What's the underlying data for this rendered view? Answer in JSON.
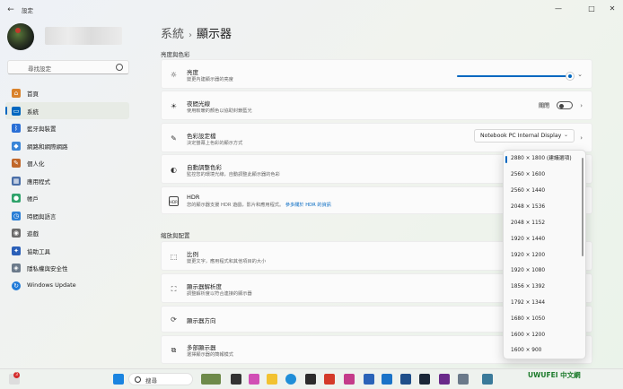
{
  "window": {
    "app_title": "設定",
    "back": "←",
    "minimize": "—",
    "maximize": "□",
    "close": "✕"
  },
  "sidebar": {
    "search_placeholder": "尋找設定",
    "items": [
      {
        "label": "首頁",
        "color": "#d9822b",
        "icon": "home-icon"
      },
      {
        "label": "系統",
        "color": "#0067c0",
        "icon": "system-icon"
      },
      {
        "label": "藍牙與裝置",
        "color": "#2a6fd6",
        "icon": "bluetooth-icon"
      },
      {
        "label": "網路和網際網路",
        "color": "#3a86d8",
        "icon": "wifi-icon"
      },
      {
        "label": "個人化",
        "color": "#c0672a",
        "icon": "brush-icon"
      },
      {
        "label": "應用程式",
        "color": "#4a6fa8",
        "icon": "apps-icon"
      },
      {
        "label": "帳戶",
        "color": "#2fa36b",
        "icon": "account-icon"
      },
      {
        "label": "時間與語言",
        "color": "#2b7fd6",
        "icon": "globe-clock-icon"
      },
      {
        "label": "遊戲",
        "color": "#6b6b6b",
        "icon": "gamepad-icon"
      },
      {
        "label": "協助工具",
        "color": "#2a5fb8",
        "icon": "accessibility-icon"
      },
      {
        "label": "隱私權與安全性",
        "color": "#6b7a8a",
        "icon": "shield-icon"
      },
      {
        "label": "Windows Update",
        "color": "#1f7ad8",
        "icon": "update-icon"
      }
    ]
  },
  "header": {
    "parent": "系統",
    "separator": "›",
    "current": "顯示器"
  },
  "sections": {
    "brightness_color": "亮度與色彩",
    "scale_layout": "縮放與配置"
  },
  "settings": {
    "brightness": {
      "title": "亮度",
      "desc": "變更內建顯示器的亮度",
      "value_percent": 100
    },
    "night_light": {
      "title": "夜間光線",
      "desc": "使用較暖的顏色以協助封鎖藍光",
      "state": "關閉"
    },
    "color_profile": {
      "title": "色彩設定檔",
      "desc": "決定螢幕上色彩的顯示方式",
      "value": "Notebook PC Internal Display"
    },
    "auto_color": {
      "title": "自動調整色彩",
      "desc": "監控您的環境光線，自動調整此顯示器的色彩"
    },
    "hdr": {
      "title": "HDR",
      "desc": "您的顯示器支援 HDR 遊戲，影片和應用程式。",
      "link": "參多關於 HDR 的資訊"
    },
    "scale": {
      "title": "比例",
      "desc": "變更文字，應用程式和其他項目的大小"
    },
    "resolution": {
      "title": "顯示器解析度",
      "desc": "調整解析度以符合連接的顯示器"
    },
    "orientation": {
      "title": "顯示器方向"
    },
    "multi_display": {
      "title": "多部顯示器",
      "desc": "選擇顯示器的簡報模式"
    }
  },
  "resolution_options": [
    "2880 × 1800 (建議選項)",
    "2560 × 1600",
    "2560 × 1440",
    "2048 × 1536",
    "2048 × 1152",
    "1920 × 1440",
    "1920 × 1200",
    "1920 × 1080",
    "1856 × 1392",
    "1792 × 1344",
    "1680 × 1050",
    "1600 × 1200",
    "1600 × 900"
  ],
  "selected_resolution_index": 0,
  "taskbar": {
    "search_label": "搜尋",
    "notification_badge": "3",
    "watermark": "UWUFEI 中文網"
  },
  "colors": {
    "accent": "#0067c0"
  }
}
